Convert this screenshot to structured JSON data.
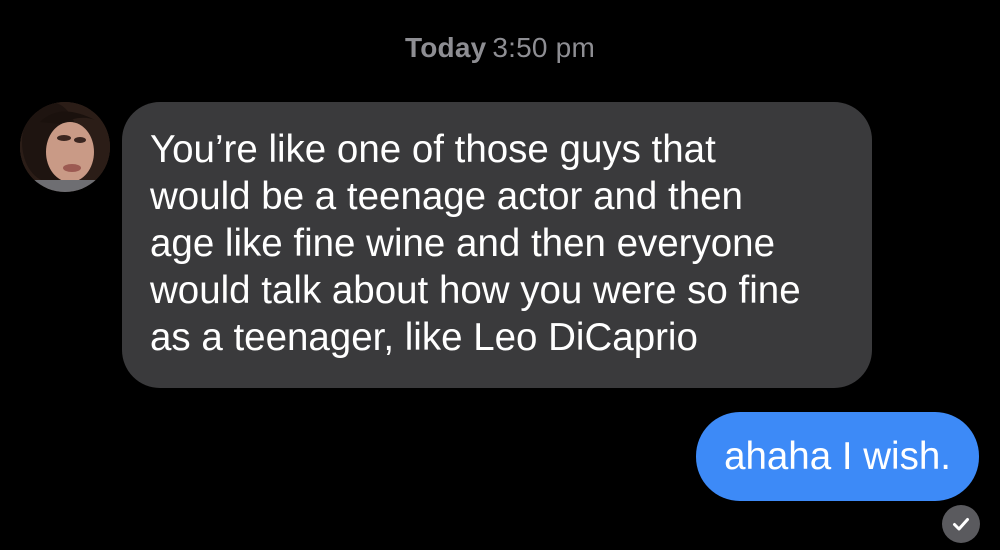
{
  "timestamp": {
    "day": "Today",
    "time": "3:50 pm"
  },
  "incoming_message": {
    "avatar_icon": "contact-avatar",
    "lines": [
      "You’re like one of those guys that",
      "would be a teenage actor and then",
      "age like fine wine and then everyone",
      "would talk about how you were so fine",
      "as a teenager, like Leo DiCaprio"
    ]
  },
  "outgoing_message": {
    "text": "ahaha I wish.",
    "status_icon": "read-checkmark-icon"
  },
  "colors": {
    "background": "#000000",
    "incoming_bubble": "#3a3a3c",
    "outgoing_bubble": "#3d8af7",
    "timestamp_text": "#8e8e93"
  }
}
